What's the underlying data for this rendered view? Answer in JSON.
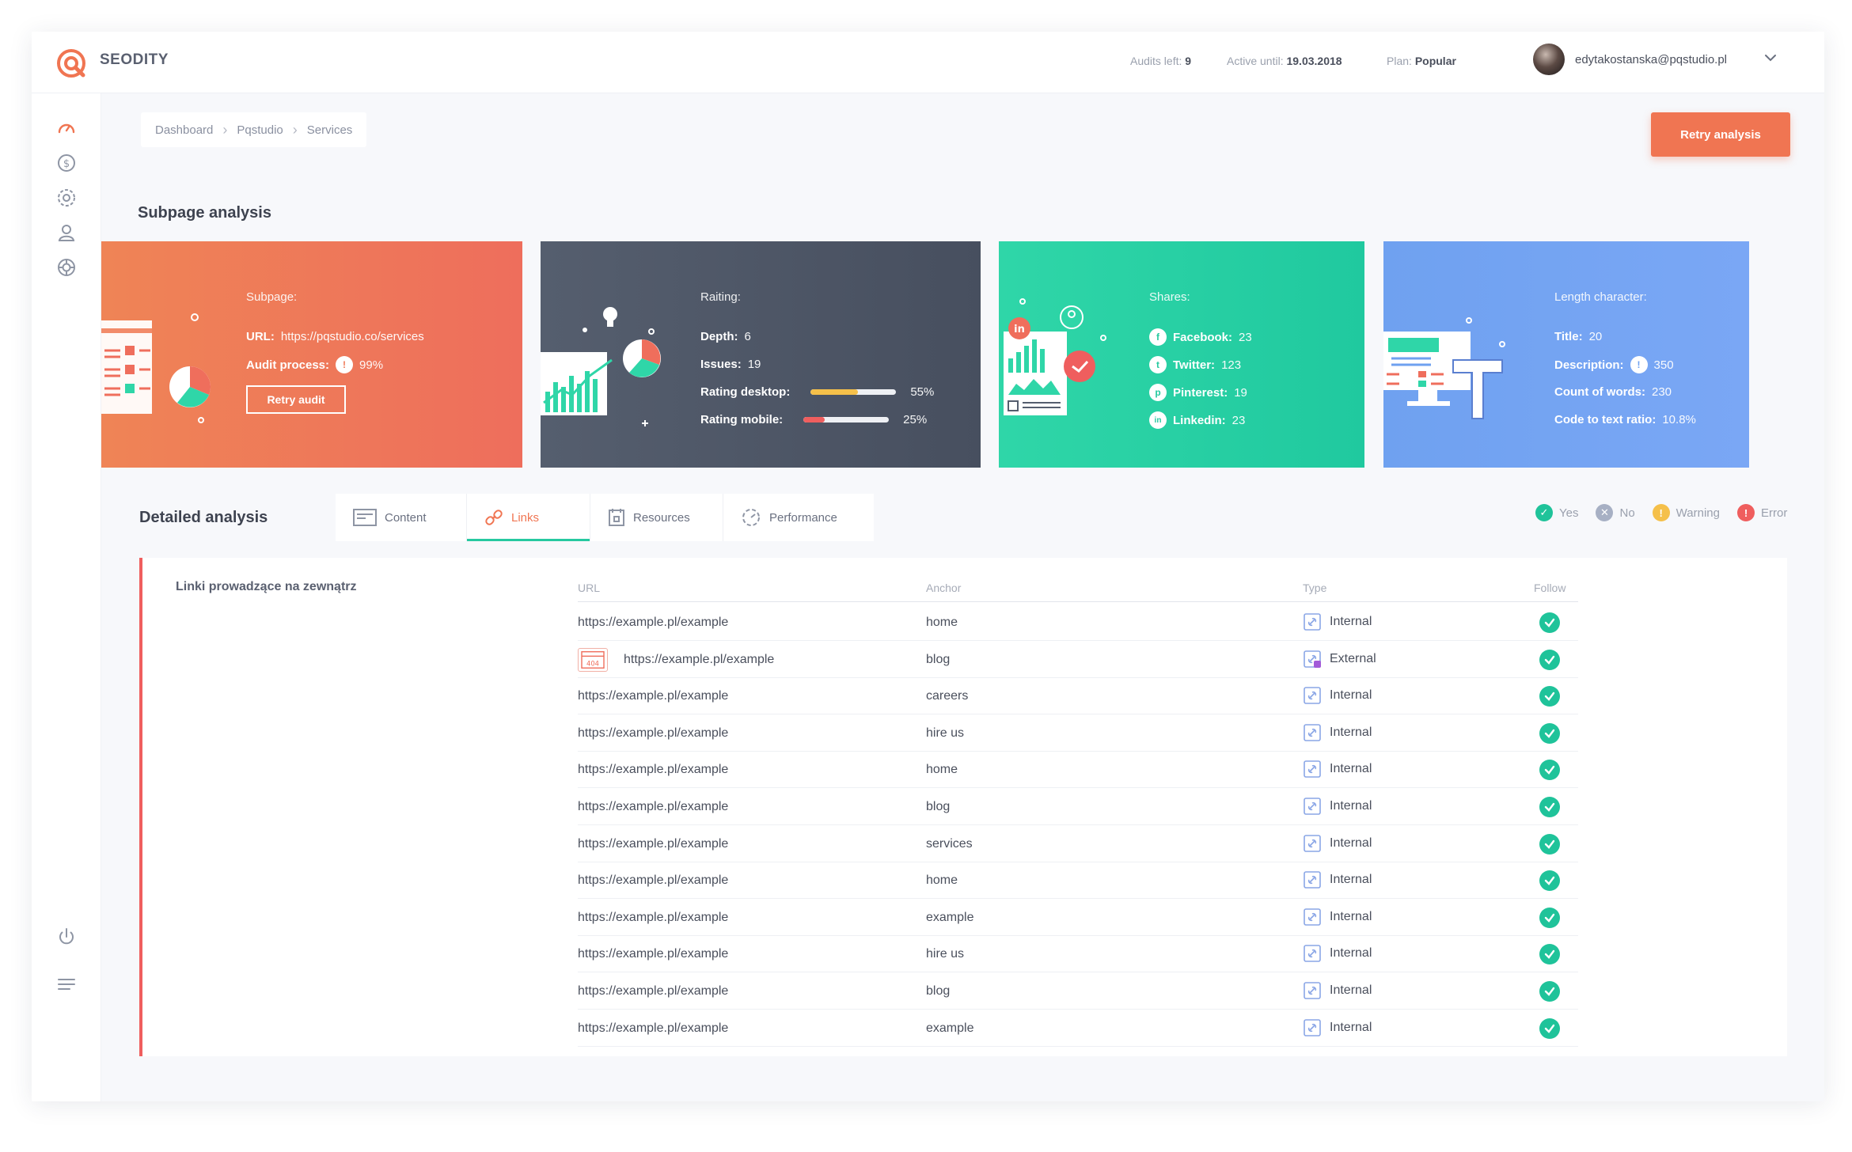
{
  "topbar": {
    "brand": "SEODITY",
    "audits_left_label": "Audits left:",
    "audits_left_value": "9",
    "active_until_label": "Active until:",
    "active_until_value": "19.03.2018",
    "plan_label": "Plan:",
    "plan_value": "Popular",
    "user_email": "edytakostanska@pqstudio.pl"
  },
  "sidebar": {
    "items": [
      {
        "icon": "dashboard-icon"
      },
      {
        "icon": "dollar-icon"
      },
      {
        "icon": "settings-icon"
      },
      {
        "icon": "user-icon"
      },
      {
        "icon": "support-icon"
      }
    ],
    "bottom": [
      {
        "icon": "power-icon"
      },
      {
        "icon": "menu-icon"
      }
    ]
  },
  "breadcrumb": [
    "Dashboard",
    "Pqstudio",
    "Services"
  ],
  "retry_analysis_label": "Retry analysis",
  "section_title": "Subpage analysis",
  "cards": {
    "subpage": {
      "title": "Subpage:",
      "url_label": "URL:",
      "url_value": "https://pqstudio.co/services",
      "audit_label": "Audit process:",
      "audit_value": "99%",
      "button": "Retry audit"
    },
    "rating": {
      "title": "Raiting:",
      "depth_label": "Depth:",
      "depth_value": "6",
      "issues_label": "Issues:",
      "issues_value": "19",
      "desktop_label": "Rating desktop:",
      "desktop_value": "55%",
      "desktop_level": 0.55,
      "mobile_label": "Rating mobile:",
      "mobile_value": "25%",
      "mobile_level": 0.25
    },
    "shares": {
      "title": "Shares:",
      "facebook_label": "Facebook:",
      "facebook_value": "23",
      "twitter_label": "Twitter:",
      "twitter_value": "123",
      "pinterest_label": "Pinterest:",
      "pinterest_value": "19",
      "linkedin_label": "Linkedin:",
      "linkedin_value": "23"
    },
    "length": {
      "title": "Length character:",
      "title_label": "Title:",
      "title_value": "20",
      "description_label": "Description:",
      "description_value": "350",
      "words_label": "Count of words:",
      "words_value": "230",
      "ratio_label": "Code to text ratio:",
      "ratio_value": "10.8%"
    }
  },
  "detailed": {
    "title": "Detailed analysis",
    "tabs": [
      "Content",
      "Links",
      "Resources",
      "Performance"
    ],
    "active_tab": "Links",
    "legend": {
      "yes": "Yes",
      "no": "No",
      "warning": "Warning",
      "error": "Error"
    }
  },
  "links_table": {
    "title": "Linki prowadzące na zewnątrz",
    "headers": {
      "url": "URL",
      "anchor": "Anchor",
      "type": "Type",
      "follow": "Follow"
    },
    "rows": [
      {
        "url": "https://example.pl/example",
        "anchor": "home",
        "type": "Internal"
      },
      {
        "url": "https://example.pl/example",
        "anchor": "blog",
        "type": "External",
        "badge": "404"
      },
      {
        "url": "https://example.pl/example",
        "anchor": "careers",
        "type": "Internal"
      },
      {
        "url": "https://example.pl/example",
        "anchor": "hire us",
        "type": "Internal"
      },
      {
        "url": "https://example.pl/example",
        "anchor": "home",
        "type": "Internal"
      },
      {
        "url": "https://example.pl/example",
        "anchor": "blog",
        "type": "Internal"
      },
      {
        "url": "https://example.pl/example",
        "anchor": "services",
        "type": "Internal"
      },
      {
        "url": "https://example.pl/example",
        "anchor": "home",
        "type": "Internal"
      },
      {
        "url": "https://example.pl/example",
        "anchor": "example",
        "type": "Internal"
      },
      {
        "url": "https://example.pl/example",
        "anchor": "hire us",
        "type": "Internal"
      },
      {
        "url": "https://example.pl/example",
        "anchor": "blog",
        "type": "Internal"
      },
      {
        "url": "https://example.pl/example",
        "anchor": "example",
        "type": "Internal"
      }
    ]
  },
  "colors": {
    "accent": "#f07552",
    "green": "#1fc39a",
    "red": "#ef5e5e",
    "warning": "#f5c04a",
    "no": "#a7b0c4"
  }
}
